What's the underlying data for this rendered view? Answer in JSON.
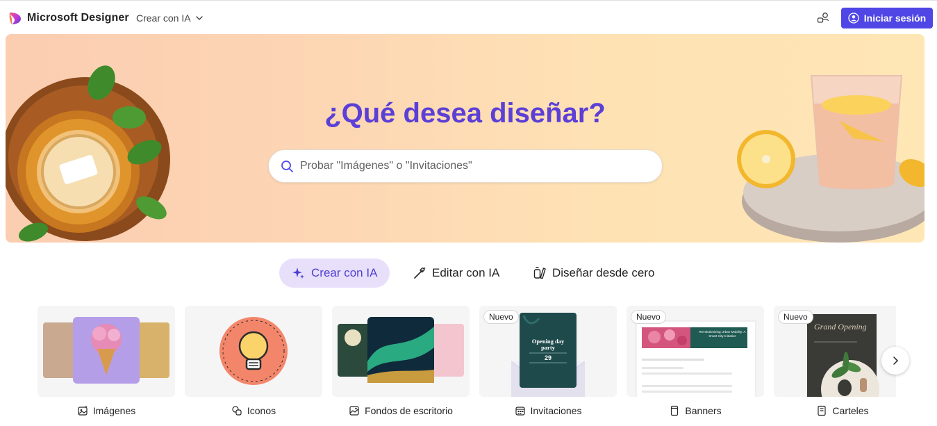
{
  "header": {
    "brand": "Microsoft Designer",
    "nav_menu_label": "Crear con IA",
    "signin_label": "Iniciar sesión"
  },
  "hero": {
    "title": "¿Qué desea diseñar?",
    "search_placeholder": "Probar \"Imágenes\" o \"Invitaciones\""
  },
  "tabs": [
    {
      "label": "Crear con IA",
      "icon": "sparkle-icon",
      "active": true
    },
    {
      "label": "Editar con IA",
      "icon": "magic-wand-icon",
      "active": false
    },
    {
      "label": "Diseñar desde cero",
      "icon": "design-tools-icon",
      "active": false
    }
  ],
  "cards": [
    {
      "label": "Imágenes",
      "icon": "image-sparkle-icon",
      "badge": ""
    },
    {
      "label": "Iconos",
      "icon": "icons-icon",
      "badge": ""
    },
    {
      "label": "Fondos de escritorio",
      "icon": "wallpaper-icon",
      "badge": ""
    },
    {
      "label": "Invitaciones",
      "icon": "calendar-icon",
      "badge": "Nuevo",
      "preview": {
        "title": "Opening day party",
        "day": "29"
      }
    },
    {
      "label": "Banners",
      "icon": "banner-icon",
      "badge": "Nuevo",
      "preview": {
        "title": "Revolutionizing Urban Mobility: A Smart City Initiative"
      }
    },
    {
      "label": "Carteles",
      "icon": "poster-icon",
      "badge": "Nuevo",
      "preview": {
        "title": "Grand Opening"
      }
    }
  ],
  "colors": {
    "accent": "#4f46e5",
    "hero_title": "#5b3fd6",
    "active_tab_bg": "#e8e0fb"
  }
}
